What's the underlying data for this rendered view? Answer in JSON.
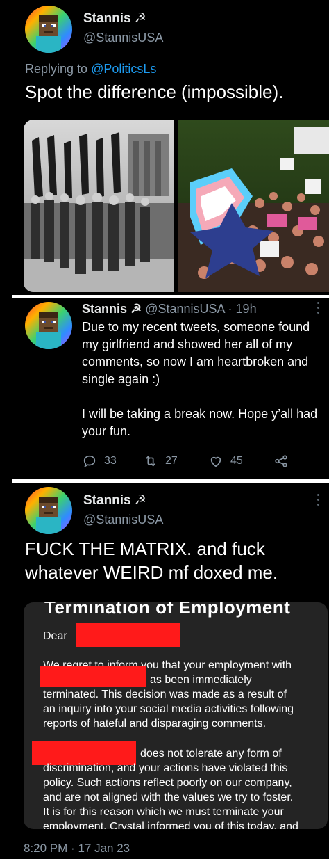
{
  "tweet1": {
    "name": "Stannis",
    "symbol": "☭",
    "handle": "@StannisUSA",
    "replying_prefix": "Replying to",
    "replying_to": "@PoliticsLs",
    "text": "Spot the difference (impossible)."
  },
  "tweet2": {
    "name": "Stannis",
    "symbol": "☭",
    "handle": "@StannisUSA",
    "separator": "·",
    "time": "19h",
    "paragraph1": "Due to my recent tweets, someone found my girlfriend and showed her all of my comments, so now I am heartbroken and single again :)",
    "paragraph2": "I will be taking a break now. Hope y’all had your fun.",
    "replies": "33",
    "retweets": "27",
    "likes": "45"
  },
  "tweet3": {
    "name": "Stannis",
    "symbol": "☭",
    "handle": "@StannisUSA",
    "text_line1": "FUCK THE MATRIX. and fuck",
    "text_line2": "whatever WEIRD mf doxed me.",
    "letter": {
      "title": "Termination of Employment",
      "dear": "Dear",
      "line1": "We regret to inform you that your employment with",
      "line2": "as been immediately",
      "line3": "terminated. This decision was made as a result of",
      "line4": "an inquiry into your social media activities following",
      "line5": "reports of hateful and disparaging comments.",
      "line6": "does not tolerate any form of",
      "line7": "discrimination, and your actions have violated this",
      "line8": "policy. Such actions reflect poorly on our company,",
      "line9": "and are not aligned with the values we try to foster.",
      "line10": "It is for this reason which we must terminate your",
      "line11": "employment. Crystal informed you of this today, and"
    },
    "footer_time": "8:20 PM",
    "footer_sep": "·",
    "footer_date": "17 Jan 23"
  },
  "icons": {
    "reply": "reply-icon",
    "retweet": "retweet-icon",
    "like": "heart-icon",
    "share": "share-icon",
    "more": "more-icon"
  },
  "colors": {
    "background": "#000000",
    "text": "#e7e9ea",
    "muted": "#8b98a5",
    "link": "#1d9bf0",
    "redaction": "#ff1a1a",
    "letter_bg": "#242424"
  }
}
